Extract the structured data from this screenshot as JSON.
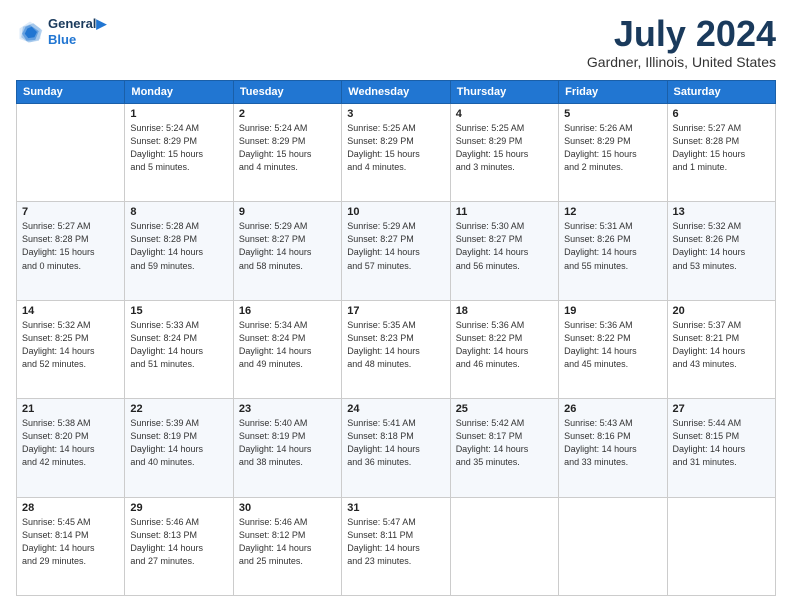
{
  "header": {
    "logo_line1": "General",
    "logo_line2": "Blue",
    "month": "July 2024",
    "location": "Gardner, Illinois, United States"
  },
  "days_of_week": [
    "Sunday",
    "Monday",
    "Tuesday",
    "Wednesday",
    "Thursday",
    "Friday",
    "Saturday"
  ],
  "weeks": [
    [
      {
        "day": "",
        "info": ""
      },
      {
        "day": "1",
        "info": "Sunrise: 5:24 AM\nSunset: 8:29 PM\nDaylight: 15 hours\nand 5 minutes."
      },
      {
        "day": "2",
        "info": "Sunrise: 5:24 AM\nSunset: 8:29 PM\nDaylight: 15 hours\nand 4 minutes."
      },
      {
        "day": "3",
        "info": "Sunrise: 5:25 AM\nSunset: 8:29 PM\nDaylight: 15 hours\nand 4 minutes."
      },
      {
        "day": "4",
        "info": "Sunrise: 5:25 AM\nSunset: 8:29 PM\nDaylight: 15 hours\nand 3 minutes."
      },
      {
        "day": "5",
        "info": "Sunrise: 5:26 AM\nSunset: 8:29 PM\nDaylight: 15 hours\nand 2 minutes."
      },
      {
        "day": "6",
        "info": "Sunrise: 5:27 AM\nSunset: 8:28 PM\nDaylight: 15 hours\nand 1 minute."
      }
    ],
    [
      {
        "day": "7",
        "info": "Sunrise: 5:27 AM\nSunset: 8:28 PM\nDaylight: 15 hours\nand 0 minutes."
      },
      {
        "day": "8",
        "info": "Sunrise: 5:28 AM\nSunset: 8:28 PM\nDaylight: 14 hours\nand 59 minutes."
      },
      {
        "day": "9",
        "info": "Sunrise: 5:29 AM\nSunset: 8:27 PM\nDaylight: 14 hours\nand 58 minutes."
      },
      {
        "day": "10",
        "info": "Sunrise: 5:29 AM\nSunset: 8:27 PM\nDaylight: 14 hours\nand 57 minutes."
      },
      {
        "day": "11",
        "info": "Sunrise: 5:30 AM\nSunset: 8:27 PM\nDaylight: 14 hours\nand 56 minutes."
      },
      {
        "day": "12",
        "info": "Sunrise: 5:31 AM\nSunset: 8:26 PM\nDaylight: 14 hours\nand 55 minutes."
      },
      {
        "day": "13",
        "info": "Sunrise: 5:32 AM\nSunset: 8:26 PM\nDaylight: 14 hours\nand 53 minutes."
      }
    ],
    [
      {
        "day": "14",
        "info": "Sunrise: 5:32 AM\nSunset: 8:25 PM\nDaylight: 14 hours\nand 52 minutes."
      },
      {
        "day": "15",
        "info": "Sunrise: 5:33 AM\nSunset: 8:24 PM\nDaylight: 14 hours\nand 51 minutes."
      },
      {
        "day": "16",
        "info": "Sunrise: 5:34 AM\nSunset: 8:24 PM\nDaylight: 14 hours\nand 49 minutes."
      },
      {
        "day": "17",
        "info": "Sunrise: 5:35 AM\nSunset: 8:23 PM\nDaylight: 14 hours\nand 48 minutes."
      },
      {
        "day": "18",
        "info": "Sunrise: 5:36 AM\nSunset: 8:22 PM\nDaylight: 14 hours\nand 46 minutes."
      },
      {
        "day": "19",
        "info": "Sunrise: 5:36 AM\nSunset: 8:22 PM\nDaylight: 14 hours\nand 45 minutes."
      },
      {
        "day": "20",
        "info": "Sunrise: 5:37 AM\nSunset: 8:21 PM\nDaylight: 14 hours\nand 43 minutes."
      }
    ],
    [
      {
        "day": "21",
        "info": "Sunrise: 5:38 AM\nSunset: 8:20 PM\nDaylight: 14 hours\nand 42 minutes."
      },
      {
        "day": "22",
        "info": "Sunrise: 5:39 AM\nSunset: 8:19 PM\nDaylight: 14 hours\nand 40 minutes."
      },
      {
        "day": "23",
        "info": "Sunrise: 5:40 AM\nSunset: 8:19 PM\nDaylight: 14 hours\nand 38 minutes."
      },
      {
        "day": "24",
        "info": "Sunrise: 5:41 AM\nSunset: 8:18 PM\nDaylight: 14 hours\nand 36 minutes."
      },
      {
        "day": "25",
        "info": "Sunrise: 5:42 AM\nSunset: 8:17 PM\nDaylight: 14 hours\nand 35 minutes."
      },
      {
        "day": "26",
        "info": "Sunrise: 5:43 AM\nSunset: 8:16 PM\nDaylight: 14 hours\nand 33 minutes."
      },
      {
        "day": "27",
        "info": "Sunrise: 5:44 AM\nSunset: 8:15 PM\nDaylight: 14 hours\nand 31 minutes."
      }
    ],
    [
      {
        "day": "28",
        "info": "Sunrise: 5:45 AM\nSunset: 8:14 PM\nDaylight: 14 hours\nand 29 minutes."
      },
      {
        "day": "29",
        "info": "Sunrise: 5:46 AM\nSunset: 8:13 PM\nDaylight: 14 hours\nand 27 minutes."
      },
      {
        "day": "30",
        "info": "Sunrise: 5:46 AM\nSunset: 8:12 PM\nDaylight: 14 hours\nand 25 minutes."
      },
      {
        "day": "31",
        "info": "Sunrise: 5:47 AM\nSunset: 8:11 PM\nDaylight: 14 hours\nand 23 minutes."
      },
      {
        "day": "",
        "info": ""
      },
      {
        "day": "",
        "info": ""
      },
      {
        "day": "",
        "info": ""
      }
    ]
  ]
}
